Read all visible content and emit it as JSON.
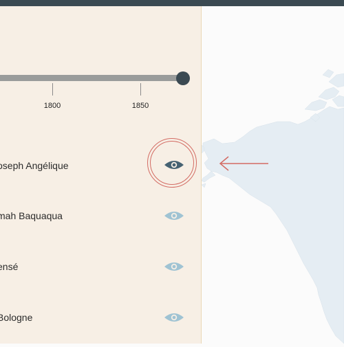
{
  "timeline": {
    "ticks": [
      "1800",
      "1850"
    ]
  },
  "people": [
    {
      "name": "oseph Angélique",
      "eye_color": "#466272"
    },
    {
      "name": "mah Baquaqua",
      "eye_color": "#9fc3d3"
    },
    {
      "name": "ensé",
      "eye_color": "#9fc3d3"
    },
    {
      "name": "Bologne",
      "eye_color": "#9fc3d3"
    }
  ],
  "colors": {
    "sidebar_bg": "#f7efe5",
    "map_land": "#e5edf3",
    "accent_red": "#d36b63",
    "dark": "#3b4a52"
  }
}
